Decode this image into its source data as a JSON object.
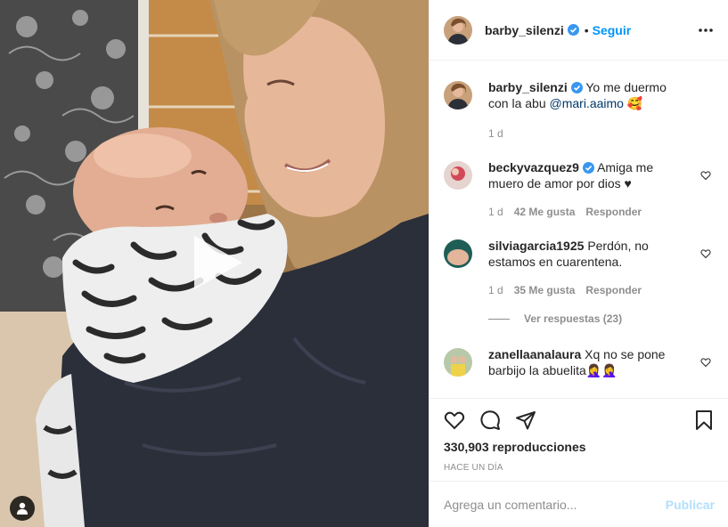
{
  "post": {
    "author": "barby_silenzi",
    "dot": "•",
    "follow_label": "Seguir",
    "more_icon": "more-horizontal-icon"
  },
  "caption": {
    "username": "barby_silenzi",
    "text": "Yo me duermo con la abu",
    "mention": "@mari.aaimo",
    "emoji": "🥰",
    "time": "1 d"
  },
  "comments": [
    {
      "username": "beckyvazquez9",
      "verified": true,
      "text": "Amiga me muero de amor por dios ♥",
      "time": "1 d",
      "likes": "42 Me gusta",
      "reply_label": "Responder"
    },
    {
      "username": "silviagarcia1925",
      "verified": false,
      "text": "Perdón, no estamos en cuarentena.",
      "time": "1 d",
      "likes": "35 Me gusta",
      "reply_label": "Responder",
      "view_replies": "Ver respuestas (23)"
    },
    {
      "username": "zanellaanalaura",
      "verified": false,
      "text": "Xq no se pone barbijo la abuelita🤦‍♀️🤦‍♀️"
    }
  ],
  "stats": {
    "views": "330,903 reproducciones",
    "date": "HACE UN DÍA"
  },
  "composer": {
    "placeholder": "Agrega un comentario...",
    "publish_label": "Publicar"
  },
  "colors": {
    "accent": "#0095f6",
    "text": "#262626",
    "muted": "#8e8e8e",
    "border": "#efefef",
    "publish_disabled": "#b2dffc"
  }
}
